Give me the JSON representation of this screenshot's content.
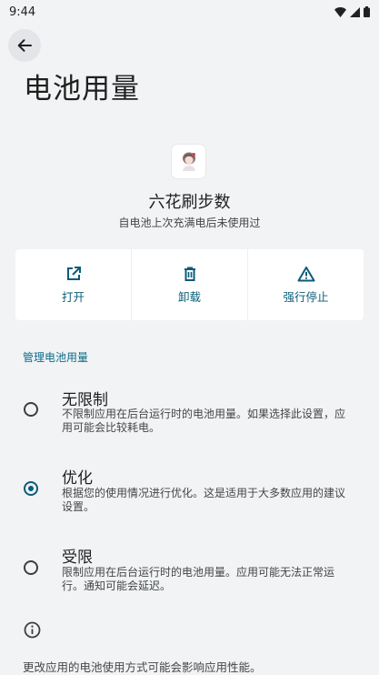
{
  "status": {
    "time": "9:44"
  },
  "page": {
    "title": "电池用量"
  },
  "app": {
    "name": "六花刷步数",
    "subtitle": "自电池上次充满电后未使用过"
  },
  "actions": [
    {
      "label": "打开",
      "icon": "open-in-new-icon"
    },
    {
      "label": "卸载",
      "icon": "trash-icon"
    },
    {
      "label": "强行停止",
      "icon": "warning-icon"
    }
  ],
  "section": {
    "title": "管理电池用量"
  },
  "options": [
    {
      "title": "无限制",
      "desc": "不限制应用在后台运行时的电池用量。如果选择此设置，应用可能会比较耗电。",
      "selected": false
    },
    {
      "title": "优化",
      "desc": "根据您的使用情况进行优化。这是适用于大多数应用的建议设置。",
      "selected": true
    },
    {
      "title": "受限",
      "desc": "限制应用在后台运行时的电池用量。应用可能无法正常运行。通知可能会延迟。",
      "selected": false
    }
  ],
  "footer": {
    "text": "更改应用的电池使用方式可能会影响应用性能。"
  },
  "colors": {
    "accent": "#0b5c7a",
    "background": "#f1f3f4",
    "card": "#ffffff"
  }
}
